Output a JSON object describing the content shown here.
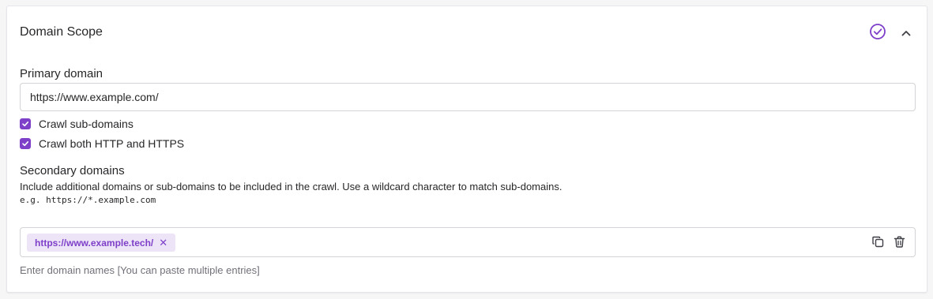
{
  "section": {
    "title": "Domain Scope"
  },
  "primary": {
    "label": "Primary domain",
    "value": "https://www.example.com/"
  },
  "options": [
    {
      "label": "Crawl sub-domains",
      "checked": true
    },
    {
      "label": "Crawl both HTTP and HTTPS",
      "checked": true
    }
  ],
  "secondary": {
    "label": "Secondary domains",
    "help": "Include additional domains or sub-domains to be included in the crawl. Use a wildcard character to match sub-domains.",
    "example": "e.g. https://*.example.com",
    "tags": [
      {
        "label": "https://www.example.tech/"
      }
    ],
    "remove_glyph": "✕",
    "placeholder": "Enter domain names [You can paste multiple entries]"
  },
  "icons": {
    "status": "check-circle-icon",
    "collapse": "chevron-up-icon",
    "copy": "copy-icon",
    "delete": "trash-icon"
  },
  "colors": {
    "accent": "#7e3fc9",
    "chip_bg": "#ede4f8",
    "border": "#d4d4d8"
  }
}
